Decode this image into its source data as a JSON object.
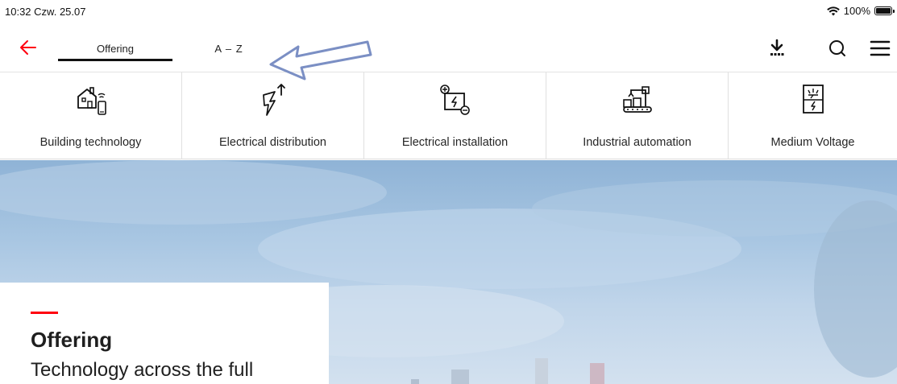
{
  "status_bar": {
    "time": "10:32",
    "date": "Czw. 25.07",
    "battery_text": "100%",
    "battery_level": 1.0
  },
  "nav": {
    "back_icon": "arrow-left-icon",
    "tabs": [
      {
        "label": "Offering",
        "active": true
      },
      {
        "label": "A – Z",
        "active": false
      }
    ],
    "actions": [
      "download-icon",
      "search-icon",
      "menu-icon"
    ]
  },
  "categories": [
    {
      "label": "Building technology",
      "icon": "smart-home-icon"
    },
    {
      "label": "Electrical distribution",
      "icon": "lightning-icon"
    },
    {
      "label": "Electrical installation",
      "icon": "electrical-panel-icon"
    },
    {
      "label": "Industrial automation",
      "icon": "robot-factory-icon"
    },
    {
      "label": "Medium Voltage",
      "icon": "voltage-meter-icon"
    }
  ],
  "hero": {
    "title": "Offering",
    "subtitle": "Technology across the full"
  },
  "colors": {
    "accent_red": "#ff000f",
    "annotation_arrow": "#7b8fc4",
    "text": "#1f1f1f",
    "sky": "#a8c6e2"
  }
}
